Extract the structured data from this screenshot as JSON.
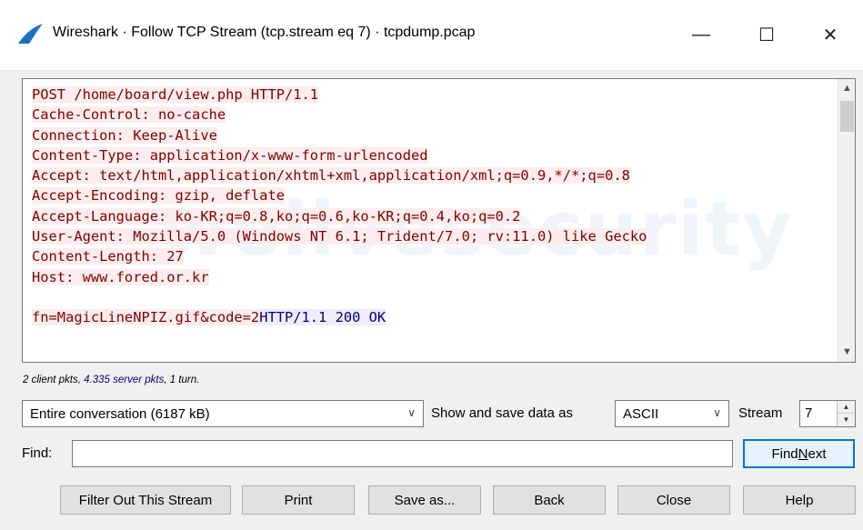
{
  "window": {
    "title": "Wireshark · Follow TCP Stream (tcp.stream eq 7) · tcpdump.pcap",
    "controls": {
      "minimize": "—",
      "maximize": "☐",
      "close": "✕"
    },
    "icon": "wireshark-fin-icon",
    "accent_color": "#1e6fc0"
  },
  "stream": {
    "watermark": "welivesecurity",
    "lines": [
      {
        "text": "POST /home/board/view.php HTTP/1.1",
        "side": "client"
      },
      {
        "text": "Cache-Control: no-cache",
        "side": "client"
      },
      {
        "text": "Connection: Keep-Alive",
        "side": "client"
      },
      {
        "text": "Content-Type: application/x-www-form-urlencoded",
        "side": "client"
      },
      {
        "text": "Accept: text/html,application/xhtml+xml,application/xml;q=0.9,*/*;q=0.8",
        "side": "client"
      },
      {
        "text": "Accept-Encoding: gzip, deflate",
        "side": "client"
      },
      {
        "text": "Accept-Language: ko-KR;q=0.8,ko;q=0.6,ko-KR;q=0.4,ko;q=0.2",
        "side": "client"
      },
      {
        "text": "User-Agent: Mozilla/5.0 (Windows NT 6.1; Trident/7.0; rv:11.0) like Gecko",
        "side": "client"
      },
      {
        "text": "Content-Length: 27",
        "side": "client"
      },
      {
        "text": "Host: www.fored.or.kr",
        "side": "client"
      },
      {
        "text": "",
        "side": "none"
      }
    ],
    "last_line": {
      "client_part": "fn=MagicLineNPIZ.gif&code=2",
      "server_part": "HTTP/1.1 200 OK"
    },
    "client_color": "#7f0000",
    "client_bg": "#fbeded",
    "server_color": "#00007f",
    "server_bg": "#ededfb"
  },
  "stats": {
    "client_text": "2 client pkts, ",
    "server_text": "4.335 server pkts",
    "turns_text": ", 1 turn."
  },
  "controls": {
    "conversation_select": "Entire conversation (6187 kB)",
    "show_save_label": "Show and save data as",
    "format_select": "ASCII",
    "stream_label": "Stream",
    "stream_value": "7"
  },
  "find": {
    "label": "Find:",
    "value": "",
    "find_next_prefix": "Find ",
    "find_next_underlined": "N",
    "find_next_suffix": "ext"
  },
  "buttons": {
    "filter_out": "Filter Out This Stream",
    "print": "Print",
    "save_as": "Save as...",
    "back": "Back",
    "close": "Close",
    "help": "Help"
  }
}
